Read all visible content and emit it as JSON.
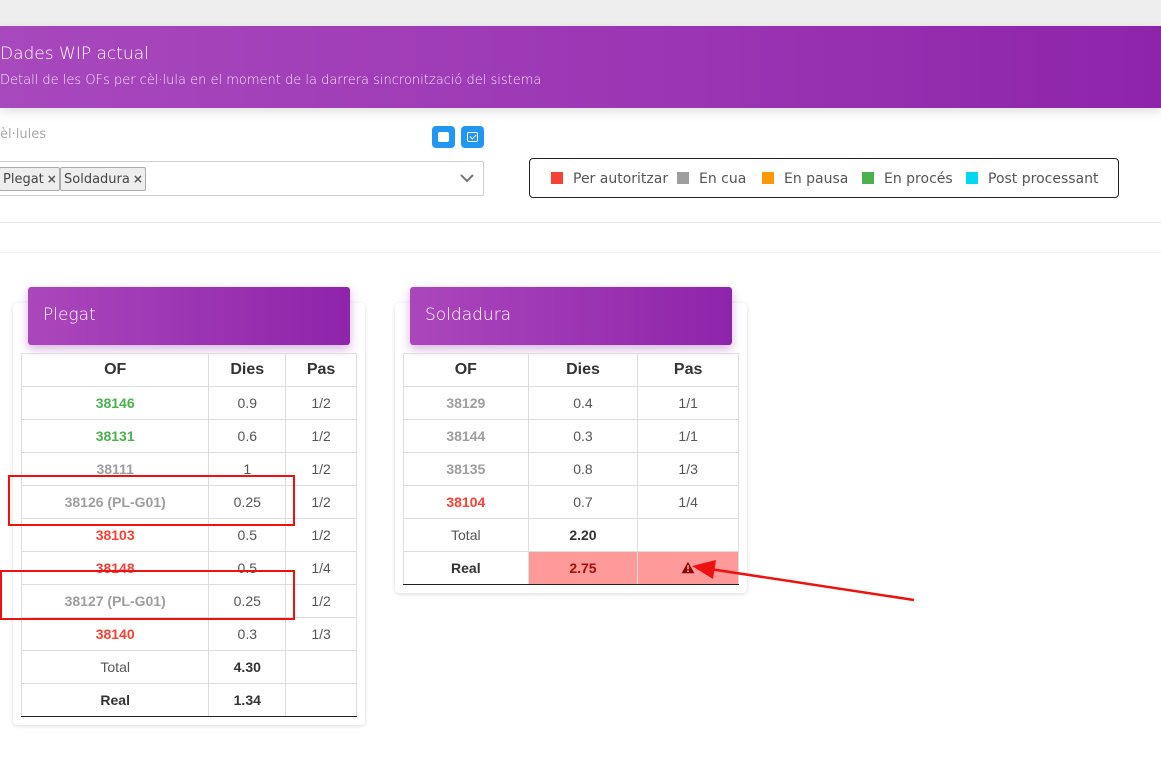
{
  "header": {
    "title": "Dades WIP actual",
    "subtitle": "Detall de les OFs per cèl·lula en el moment de la darrera sincronització del sistema"
  },
  "filter": {
    "label": "èl·lules",
    "tags": [
      "Plegat",
      "Soldadura"
    ],
    "tag_remove": "×"
  },
  "legend": [
    {
      "label": "Per autoritzar",
      "color": "#f44336"
    },
    {
      "label": "En cua",
      "color": "#9e9e9e"
    },
    {
      "label": "En pausa",
      "color": "#ff9800"
    },
    {
      "label": "En procés",
      "color": "#4caf50"
    },
    {
      "label": "Post processant",
      "color": "#00d8f0"
    }
  ],
  "columns": {
    "of": "OF",
    "dies": "Dies",
    "pas": "Pas"
  },
  "plegat": {
    "title": "Plegat",
    "rows": [
      {
        "of": "38146",
        "dies": "0.9",
        "pas": "1/2",
        "status": "green"
      },
      {
        "of": "38131",
        "dies": "0.6",
        "pas": "1/2",
        "status": "green"
      },
      {
        "of": "38111",
        "dies": "1",
        "pas": "1/2",
        "status": "gray"
      },
      {
        "of": "38126 (PL-G01)",
        "dies": "0.25",
        "pas": "1/2",
        "status": "gray"
      },
      {
        "of": "38103",
        "dies": "0.5",
        "pas": "1/2",
        "status": "red"
      },
      {
        "of": "38148",
        "dies": "0.5",
        "pas": "1/4",
        "status": "red"
      },
      {
        "of": "38127 (PL-G01)",
        "dies": "0.25",
        "pas": "1/2",
        "status": "gray"
      },
      {
        "of": "38140",
        "dies": "0.3",
        "pas": "1/3",
        "status": "red"
      }
    ],
    "total_label": "Total",
    "total_value": "4.30",
    "real_label": "Real",
    "real_value": "1.34"
  },
  "soldadura": {
    "title": "Soldadura",
    "rows": [
      {
        "of": "38129",
        "dies": "0.4",
        "pas": "1/1",
        "status": "gray"
      },
      {
        "of": "38144",
        "dies": "0.3",
        "pas": "1/1",
        "status": "gray"
      },
      {
        "of": "38135",
        "dies": "0.8",
        "pas": "1/3",
        "status": "gray"
      },
      {
        "of": "38104",
        "dies": "0.7",
        "pas": "1/4",
        "status": "red"
      }
    ],
    "total_label": "Total",
    "total_value": "2.20",
    "real_label": "Real",
    "real_value": "2.75",
    "real_warning_icon": "warning-icon"
  }
}
